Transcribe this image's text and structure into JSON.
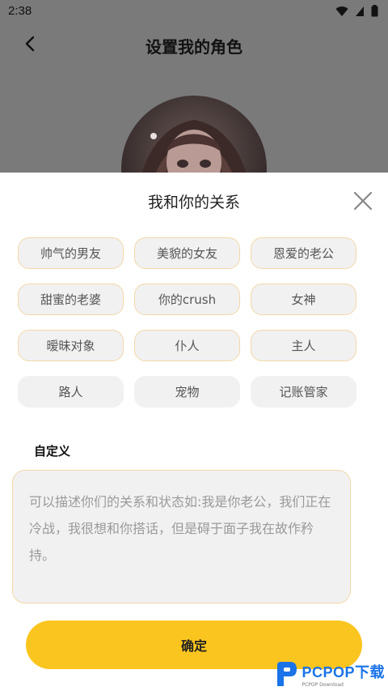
{
  "status_bar": {
    "time": "2:38"
  },
  "header": {
    "title": "设置我的角色"
  },
  "sheet": {
    "title": "我和你的关系",
    "chips": [
      {
        "label": "帅气的男友",
        "highlighted": true
      },
      {
        "label": "美貌的女友",
        "highlighted": true
      },
      {
        "label": "恩爱的老公",
        "highlighted": true
      },
      {
        "label": "甜蜜的老婆",
        "highlighted": true
      },
      {
        "label": "你的crush",
        "highlighted": true
      },
      {
        "label": "女神",
        "highlighted": true
      },
      {
        "label": "暧昧对象",
        "highlighted": true
      },
      {
        "label": "仆人",
        "highlighted": true
      },
      {
        "label": "主人",
        "highlighted": true
      },
      {
        "label": "路人",
        "highlighted": false
      },
      {
        "label": "宠物",
        "highlighted": false
      },
      {
        "label": "记账管家",
        "highlighted": false
      }
    ],
    "custom_label": "自定义",
    "custom_placeholder": "可以描述你们的关系和状态如:我是你老公，我们正在冷战，我很想和你搭话，但是碍于面子我在故作矜持。",
    "custom_value": "",
    "confirm_label": "确定"
  },
  "watermark": {
    "text": "PCPOP下载",
    "sub": "PCPOP Download"
  },
  "colors": {
    "accent": "#fbc51f",
    "chip_border": "#f2d8a8",
    "chip_bg": "#f1f1f1",
    "overlay": "#7a7a7a"
  }
}
